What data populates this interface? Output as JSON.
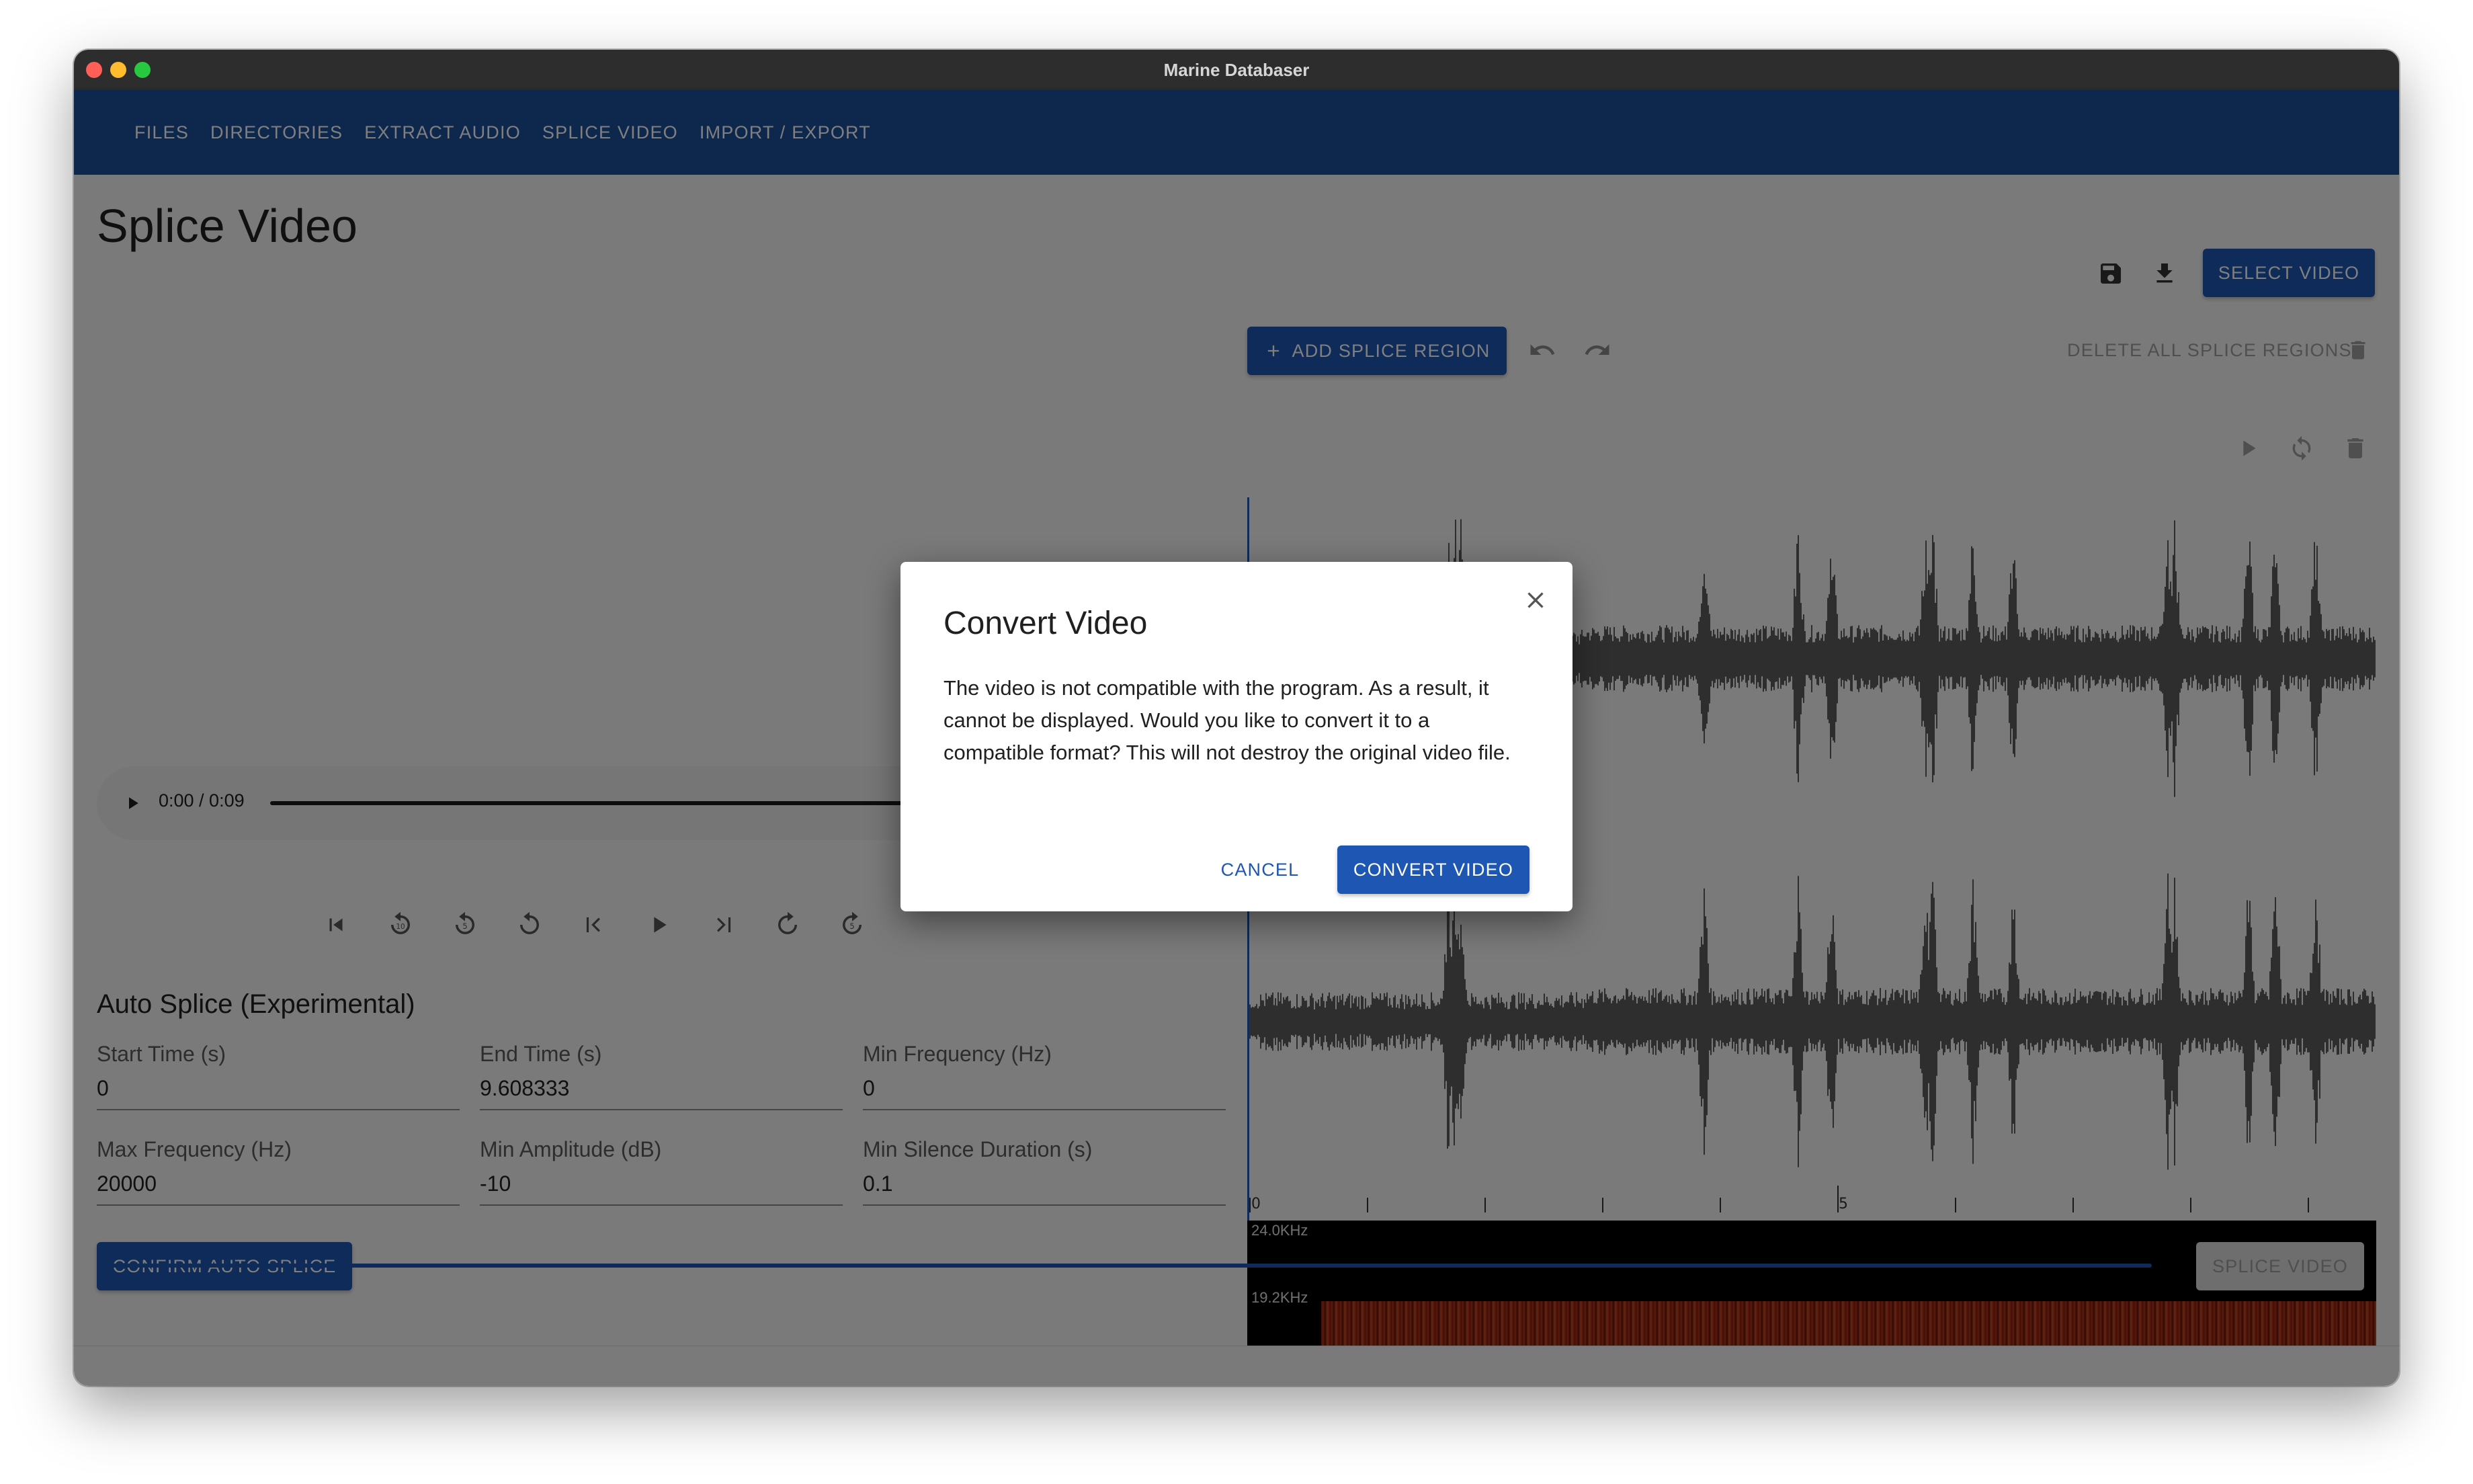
{
  "window": {
    "title": "Marine Databaser"
  },
  "nav": {
    "items": [
      "FILES",
      "DIRECTORIES",
      "EXTRACT AUDIO",
      "SPLICE VIDEO",
      "IMPORT / EXPORT"
    ]
  },
  "page": {
    "title": "Splice Video"
  },
  "toolbar": {
    "select_video": "SELECT VIDEO",
    "add_splice_region": "ADD SPLICE REGION",
    "delete_all_splice_regions": "DELETE ALL SPLICE REGIONS"
  },
  "player": {
    "time": "0:00 / 0:09"
  },
  "auto_splice": {
    "title": "Auto Splice (Experimental)",
    "fields": [
      {
        "label": "Start Time (s)",
        "value": "0"
      },
      {
        "label": "End Time (s)",
        "value": "9.608333"
      },
      {
        "label": "Min Frequency (Hz)",
        "value": "0"
      },
      {
        "label": "Max Frequency (Hz)",
        "value": "20000"
      },
      {
        "label": "Min Amplitude (dB)",
        "value": "-10"
      },
      {
        "label": "Min Silence Duration (s)",
        "value": "0.1"
      }
    ],
    "confirm": "CONFIRM AUTO SPLICE"
  },
  "timeline": {
    "ticks": [
      "0",
      "5"
    ]
  },
  "spectrogram": {
    "labels": [
      "24.0KHz",
      "19.2KHz"
    ]
  },
  "footer": {
    "splice_video": "SPLICE VIDEO"
  },
  "dialog": {
    "title": "Convert Video",
    "body": "The video is not compatible with the program. As a result, it cannot be displayed. Would you like to convert it to a compatible format? This will not destroy the original video file.",
    "cancel": "CANCEL",
    "convert": "CONVERT VIDEO"
  }
}
